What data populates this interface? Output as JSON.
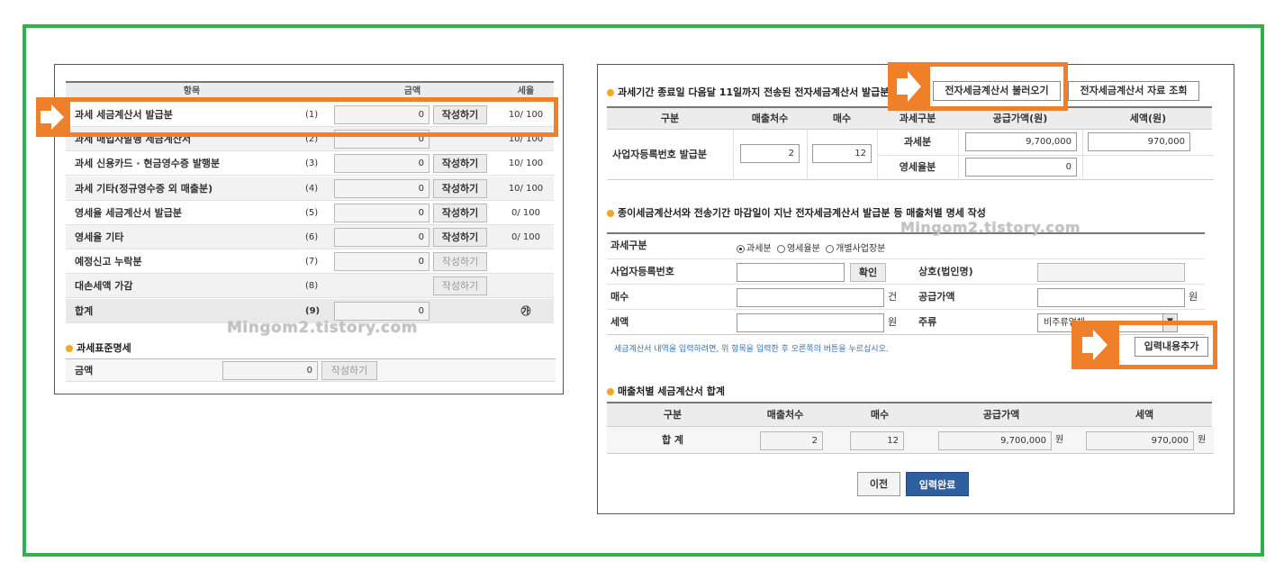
{
  "left": {
    "headers": {
      "item": "항목",
      "amount": "금액",
      "rate": "세율"
    },
    "rows": [
      {
        "label": "과세 세금계산서 발급분",
        "no": "(1)",
        "amount": "0",
        "button": "작성하기",
        "rate": "10/ 100"
      },
      {
        "label": "과세 매입자발행 세금계산서",
        "no": "(2)",
        "amount": "0",
        "button": "",
        "rate": "10/ 100"
      },
      {
        "label": "과세 신용카드 · 현금영수증 발행분",
        "no": "(3)",
        "amount": "0",
        "button": "작성하기",
        "rate": "10/ 100"
      },
      {
        "label": "과세 기타(정규영수증 외 매출분)",
        "no": "(4)",
        "amount": "0",
        "button": "작성하기",
        "rate": "10/ 100"
      },
      {
        "label": "영세율 세금계산서 발급분",
        "no": "(5)",
        "amount": "0",
        "button": "작성하기",
        "rate": "0/ 100"
      },
      {
        "label": "영세율 기타",
        "no": "(6)",
        "amount": "0",
        "button": "작성하기",
        "rate": "0/ 100"
      },
      {
        "label": "예정신고 누락분",
        "no": "(7)",
        "amount": "0",
        "button": "작성하기",
        "rate": ""
      },
      {
        "label": "대손세액 가감",
        "no": "(8)",
        "amount": "",
        "button": "작성하기",
        "rate": ""
      }
    ],
    "total": {
      "label": "합계",
      "no": "(9)",
      "amount": "0",
      "mark": "㉮"
    },
    "tax_base": {
      "title": "과세표준명세",
      "label": "금액",
      "amount": "0",
      "button": "작성하기"
    },
    "watermark": "Mingom2.tistory.com"
  },
  "right": {
    "section1": {
      "title": "과세기간 종료일 다음달 11일까지 전송된 전자세금계산서 발급분",
      "btn_load": "전자세금계산서 불러오기",
      "btn_query": "전자세금계산서 자료 조회",
      "headers": [
        "구분",
        "매출처수",
        "매수",
        "과세구분",
        "공급가액(원)",
        "세액(원)"
      ],
      "row_label": "사업자등록번호 발급분",
      "buyer_count": "2",
      "sheet_count": "12",
      "taxable_label": "과세분",
      "zero_label": "영세율분",
      "taxable_supply": "9,700,000",
      "taxable_tax": "970,000",
      "zero_supply": "0"
    },
    "section2": {
      "title": "종이세금계산서와 전송기간 마감일이 지난 전자세금계산서 발급분 등 매출처별 명세 작성",
      "tax_type_label": "과세구분",
      "radio_options": [
        "과세분",
        "영세율분",
        "개별사업장분"
      ],
      "brn_label": "사업자등록번호",
      "confirm_button": "확인",
      "company_label": "상호(법인명)",
      "count_label": "매수",
      "count_unit": "건",
      "supply_label": "공급가액",
      "supply_unit": "원",
      "tax_label": "세액",
      "tax_unit": "원",
      "kind_label": "주류",
      "kind_value": "비주류업체",
      "note": "세금계산서 내역을 입력하려면, 위 항목을 입력한 후 오른쪽의 버튼을 누르십시오.",
      "add_button": "입력내용추가"
    },
    "section3": {
      "title": "매출처별 세금계산서 합계",
      "headers": [
        "구분",
        "매출처수",
        "매수",
        "공급가액",
        "세액"
      ],
      "total_label": "합 계",
      "buyer_count": "2",
      "sheet_count": "12",
      "supply": "9,700,000",
      "tax": "970,000",
      "unit": "원"
    },
    "btn_prev": "이전",
    "btn_done": "입력완료",
    "watermark": "Mingom2.tistory.com"
  },
  "colors": {
    "frame": "#2db34a",
    "highlight": "#f07f2a",
    "primary_button": "#2f5f9e"
  }
}
